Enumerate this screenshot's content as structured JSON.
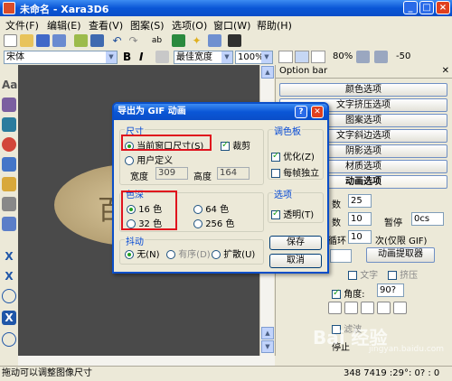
{
  "window": {
    "title": "未命名 - Xara3D6"
  },
  "menu": [
    "文件(F)",
    "编辑(E)",
    "查看(V)",
    "图案(S)",
    "选项(O)",
    "窗口(W)",
    "帮助(H)"
  ],
  "format_bar": {
    "font": "宋体",
    "bold": "B",
    "italic": "I",
    "width_mode": "最佳宽度",
    "zoom": "100%",
    "size_pct": "80%",
    "offset": "-50"
  },
  "left_tools_text": [
    "Aa",
    "X",
    "X",
    "X"
  ],
  "canvas": {
    "big_char": "百"
  },
  "panel": {
    "header": "Option bar",
    "close": "✕",
    "buttons": [
      "颜色选项",
      "文字挤压选项",
      "图案选项",
      "文字斜边选项",
      "阴影选项",
      "材质选项",
      "动画选项"
    ],
    "row1_label": "数",
    "row1_value": "25",
    "row2_label": "数",
    "row2_value": "10",
    "pause_label": "暂停",
    "pause_value": "0cs",
    "loop_label": "循环",
    "loop_value": "10",
    "loop_suffix": "次(仅限 GIF)",
    "anim_extract": "动画提取器",
    "text_opt": "文字",
    "extrude_opt": "挤压",
    "angle_label": "角度:",
    "angle_value": "90?",
    "filter_label": "滤波",
    "stop_label": "停止"
  },
  "dialog": {
    "title": "导出为 GIF 动画",
    "help": "?",
    "close": "✕",
    "size_group": "尺寸",
    "size_current": "当前窗口尺寸(S)",
    "size_crop": "裁剪",
    "size_user": "用户定义",
    "width_label": "宽度",
    "width_value": "309",
    "height_label": "高度",
    "height_value": "164",
    "palette_group": "调色板",
    "palette_opt": "优化(Z)",
    "palette_each": "每帧独立",
    "depth_group": "色深",
    "depth_16": "16 色",
    "depth_64": "64 色",
    "depth_32": "32 色",
    "depth_256": "256 色",
    "options_group": "选项",
    "transparent": "透明(T)",
    "dither_group": "抖动",
    "dither_none": "无(N)",
    "dither_ordered": "有序(D)",
    "dither_diffuse": "扩散(U)",
    "save": "保存",
    "cancel": "取消"
  },
  "status": {
    "left": "拖动可以调整图像尺寸",
    "right": "348 7419 :29°: 0? : 0"
  },
  "watermark": {
    "main": "Bai 经验",
    "sub": "jingyan.baidu.com"
  }
}
